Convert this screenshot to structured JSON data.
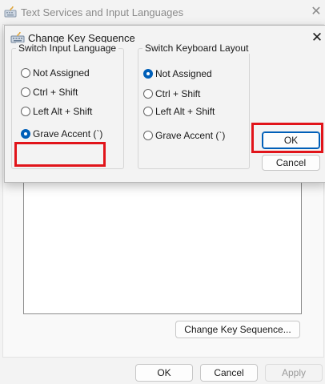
{
  "background_window": {
    "title": "Text Services and Input Languages",
    "close_glyph": "✕",
    "buttons": {
      "change_key_sequence": "Change Key Sequence...",
      "ok": "OK",
      "cancel": "Cancel",
      "apply": "Apply"
    }
  },
  "dialog": {
    "title": "Change Key Sequence",
    "close_glyph": "✕",
    "switch_input_language": {
      "legend": "Switch Input Language",
      "options": [
        "Not Assigned",
        "Ctrl + Shift",
        "Left Alt + Shift",
        "Grave Accent (`)"
      ],
      "selected": "Grave Accent (`)"
    },
    "switch_keyboard_layout": {
      "legend": "Switch Keyboard Layout",
      "options": [
        "Not Assigned",
        "Ctrl + Shift",
        "Left Alt + Shift",
        "Grave Accent (`)"
      ],
      "selected": "Not Assigned"
    },
    "buttons": {
      "ok": "OK",
      "cancel": "Cancel"
    }
  },
  "icons": {
    "app_icon": "keyboard-icon",
    "dialog_icon": "keyboard-icon",
    "close": "close-icon"
  },
  "colors": {
    "accent": "#005fb8",
    "highlight": "#e1141a"
  }
}
